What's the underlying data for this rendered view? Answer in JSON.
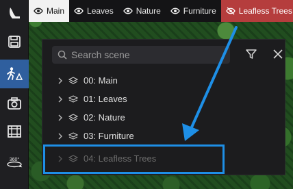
{
  "tabs": [
    {
      "label": "Main",
      "icon": "eye-icon"
    },
    {
      "label": "Leaves",
      "icon": "eye-icon"
    },
    {
      "label": "Nature",
      "icon": "eye-icon"
    },
    {
      "label": "Furniture",
      "icon": "eye-icon"
    },
    {
      "label": "Leafless Trees",
      "icon": "eye-slash-icon"
    }
  ],
  "toolbar": {
    "tools": [
      "logo-icon",
      "save-icon",
      "character-icon",
      "camera-icon",
      "film-icon",
      "360-icon"
    ],
    "label_360": "360°"
  },
  "search": {
    "placeholder": "Search scene"
  },
  "scenes": [
    {
      "label": "00: Main"
    },
    {
      "label": "01: Leaves"
    },
    {
      "label": "02: Nature"
    },
    {
      "label": "03: Furniture"
    },
    {
      "label": "04: Leafless Trees"
    }
  ],
  "colors": {
    "active_tool": "#2f5f9e",
    "hidden_tab": "#b53d3d",
    "highlight": "#1e8fe6"
  }
}
